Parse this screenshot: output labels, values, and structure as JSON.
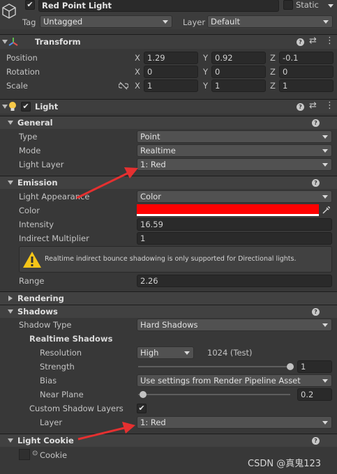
{
  "header": {
    "object_name": "Red Point Light",
    "static_label": "Static",
    "tag_label": "Tag",
    "tag_value": "Untagged",
    "layer_label": "Layer",
    "layer_value": "Default"
  },
  "transform": {
    "title": "Transform",
    "position_label": "Position",
    "rotation_label": "Rotation",
    "scale_label": "Scale",
    "axis_x": "X",
    "axis_y": "Y",
    "axis_z": "Z",
    "position": {
      "x": "1.29",
      "y": "0.92",
      "z": "-0.1"
    },
    "rotation": {
      "x": "0",
      "y": "0",
      "z": "0"
    },
    "scale": {
      "x": "1",
      "y": "1",
      "z": "1"
    }
  },
  "light": {
    "title": "Light",
    "general": {
      "title": "General",
      "type_label": "Type",
      "type_value": "Point",
      "mode_label": "Mode",
      "mode_value": "Realtime",
      "layer_label": "Light Layer",
      "layer_value": "1: Red"
    },
    "emission": {
      "title": "Emission",
      "appearance_label": "Light Appearance",
      "appearance_value": "Color",
      "color_label": "Color",
      "color_value": "#ff0000",
      "intensity_label": "Intensity",
      "intensity_value": "16.59",
      "indirect_label": "Indirect Multiplier",
      "indirect_value": "1",
      "warning_text": "Realtime indirect bounce shadowing is only supported for Directional lights.",
      "range_label": "Range",
      "range_value": "2.26"
    },
    "rendering": {
      "title": "Rendering"
    },
    "shadows": {
      "title": "Shadows",
      "type_label": "Shadow Type",
      "type_value": "Hard Shadows",
      "realtime_title": "Realtime Shadows",
      "resolution_label": "Resolution",
      "resolution_value": "High",
      "resolution_info": "1024 (Test)",
      "strength_label": "Strength",
      "strength_value": "1",
      "strength_level": 1.0,
      "bias_label": "Bias",
      "bias_value": "Use settings from Render Pipeline Asset",
      "near_plane_label": "Near Plane",
      "near_plane_value": "0.2",
      "near_plane_level": 0.0,
      "custom_layers_label": "Custom Shadow Layers",
      "custom_layers_checked": true,
      "layer_label": "Layer",
      "layer_value": "1: Red"
    },
    "cookie": {
      "title": "Light Cookie",
      "cookie_label": "Cookie"
    }
  },
  "watermark": "CSDN @真鬼123",
  "colors": {
    "background": "#383838",
    "annotation_arrow": "#e53030",
    "light_color": "#ff0000"
  }
}
